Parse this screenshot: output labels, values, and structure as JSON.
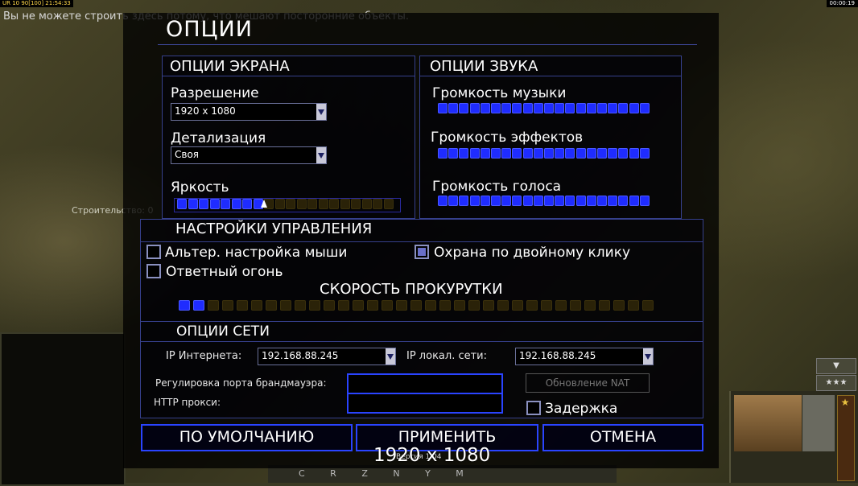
{
  "hud": {
    "status": "UR 10 90[100] 21:54:33",
    "clock": "00:00:19",
    "message": "Вы не можете строить здесь потому, что мешают посторонние объекты.",
    "build_label": "Строительство: 0"
  },
  "dialog": {
    "title": "ОПЦИИ",
    "screen": {
      "title": "ОПЦИИ ЭКРАНА",
      "resolution_label": "Разрешение",
      "resolution_value": "1920 x 1080",
      "detail_label": "Детализация",
      "detail_value": "Своя",
      "brightness_label": "Яркость",
      "brightness_level": 0.42
    },
    "sound": {
      "title": "ОПЦИИ ЗВУКА",
      "music_label": "Громкость музыки",
      "effects_label": "Громкость эффектов",
      "voice_label": "Громкость голоса",
      "music_level": 1.0,
      "effects_level": 1.0,
      "voice_level": 1.0
    },
    "controls": {
      "title": "НАСТРОЙКИ УПРАВЛЕНИЯ",
      "alt_mouse_label": "Альтер. настройка мыши",
      "alt_mouse_checked": false,
      "return_fire_label": "Ответный огонь",
      "return_fire_checked": false,
      "double_click_guard_label": "Охрана по двойному клику",
      "double_click_guard_checked": true,
      "scroll_title": "СКОРОСТЬ ПРОКУРУТКИ",
      "scroll_level": 0.06
    },
    "network": {
      "title": "ОПЦИИ СЕТИ",
      "internet_ip_label": "IP Интернета:",
      "internet_ip_value": "192.168.88.245",
      "lan_ip_label": "IP локал. сети:",
      "lan_ip_value": "192.168.88.245",
      "firewall_port_label": "Регулировка порта брандмауэра:",
      "firewall_port_value": "",
      "http_proxy_label": "HTTP прокси:",
      "http_proxy_value": "",
      "nat_refresh_label": "Обновление NAT",
      "delay_label": "Задержка",
      "delay_checked": false
    },
    "buttons": {
      "defaults": "ПО УМОЛЧАНИЮ",
      "apply": "ПРИМЕНИТЬ",
      "cancel": "ОТМЕНА"
    },
    "version": "Версия 1.04",
    "resolution_overlay": "1920 x 1080"
  },
  "sidebar": {
    "command_hotkeys": "C R Z N Y M",
    "rank_star": "★",
    "stars_button": "★★★"
  },
  "colors": {
    "accent": "#2a44ff",
    "segment_on": "#1f2cff",
    "segment_off": "#2a2208",
    "panel_border": "#36408c"
  }
}
